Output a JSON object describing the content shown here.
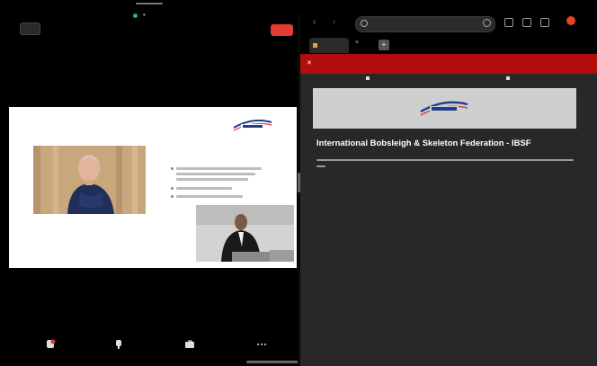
{
  "status_bar": {
    "time": "",
    "icons": "",
    "battery": ""
  },
  "meeting": {
    "title": "",
    "exit_label": "",
    "leave_label": "",
    "toolbar": [
      {
        "label": "",
        "icon": "mic-muted-icon"
      },
      {
        "label": "",
        "icon": "video-camera-icon"
      },
      {
        "label": "",
        "icon": "share-screen-icon"
      },
      {
        "label": "",
        "icon": "more-icon"
      }
    ]
  },
  "browser": {
    "url": "",
    "tab_title": "",
    "new_tab_label": "+",
    "close_tab_label": "×",
    "site_header": "",
    "subnav": [
      "",
      ""
    ],
    "page_title": "International Bobsleigh & Skeleton Federation - IBSF"
  },
  "colors": {
    "leave_red": "#e23b32",
    "site_red": "#b10d0d",
    "browser_bg": "#282828"
  }
}
